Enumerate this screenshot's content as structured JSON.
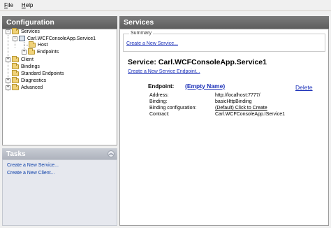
{
  "menu": [
    {
      "id": "file",
      "pre": "",
      "u": "F",
      "post": "ile"
    },
    {
      "id": "help",
      "pre": "",
      "u": "H",
      "post": "elp"
    }
  ],
  "config_panel": {
    "title": "Configuration",
    "tree": {
      "services": "Services",
      "service1": "Carl.WCFConsoleApp.Service1",
      "host": "Host",
      "endpoints": "Endpoints",
      "client": "Client",
      "bindings": "Bindings",
      "standard_endpoints": "Standard Endpoints",
      "diagnostics": "Diagnostics",
      "advanced": "Advanced"
    }
  },
  "tasks_panel": {
    "title": "Tasks",
    "links": [
      "Create a New Service...",
      "Create a New Client..."
    ]
  },
  "services_panel": {
    "title": "Services",
    "summary_label": "Summary",
    "create_service_link": "Create a New Service...",
    "service_heading": "Service: Carl.WCFConsoleApp.Service1",
    "create_endpoint_link": "Create a New Service Endpoint...",
    "endpoint": {
      "label": "Endpoint:",
      "name": "(Empty Name)",
      "delete": "Delete",
      "fields": [
        {
          "key": "Address:",
          "value": "http://localhost:7777/"
        },
        {
          "key": "Binding:",
          "value": "basicHttpBinding"
        },
        {
          "key": "Binding configuration:",
          "value": "(Default) Click to Create",
          "link": true
        },
        {
          "key": "Contract:",
          "value": "Carl.WCFConsoleApp.IService1"
        }
      ]
    }
  }
}
